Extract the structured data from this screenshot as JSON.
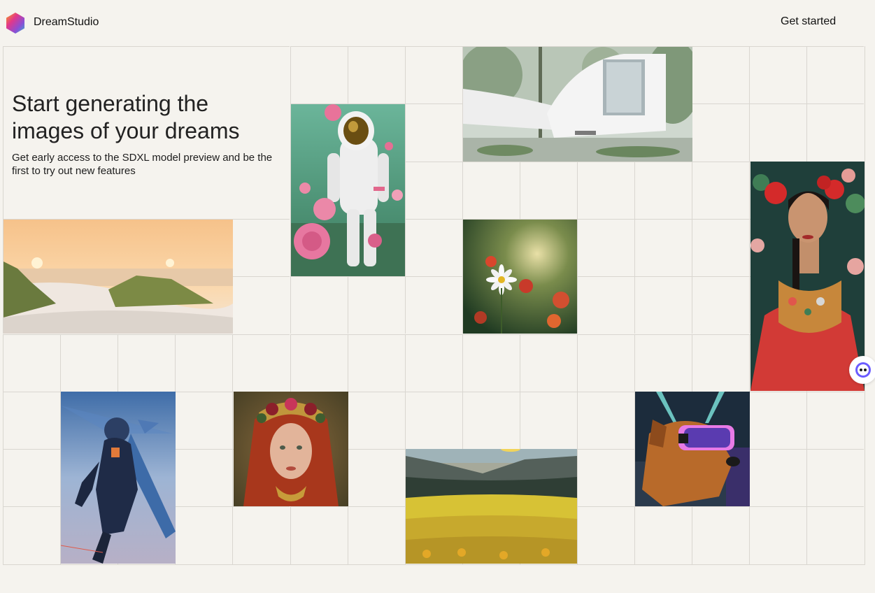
{
  "header": {
    "brand": "DreamStudio",
    "cta_label": "Get started"
  },
  "hero": {
    "headline": "Start generating the images of your dreams",
    "subtext": "Get early access to the SDXL model preview and be the first to try out new features"
  },
  "gallery": [
    {
      "name": "astronaut-roses-image",
      "subject": "astronaut among roses"
    },
    {
      "name": "modern-house-image",
      "subject": "white modern house in forest"
    },
    {
      "name": "beach-dunes-image",
      "subject": "sunset over beach dunes"
    },
    {
      "name": "daisy-flower-image",
      "subject": "daisy in garden"
    },
    {
      "name": "frida-portrait-image",
      "subject": "woman with red flowers portrait"
    },
    {
      "name": "space-warrior-image",
      "subject": "armored flying figure"
    },
    {
      "name": "red-hair-woman-image",
      "subject": "red-haired woman with floral crown"
    },
    {
      "name": "flower-valley-image",
      "subject": "yellow flower valley"
    },
    {
      "name": "vr-dog-image",
      "subject": "dog wearing VR headset"
    }
  ],
  "icons": {
    "logo": "hexagon-gradient-logo",
    "chat": "chat-bubble-icon"
  },
  "colors": {
    "background": "#f5f3ee",
    "grid_line": "#d9d6d0",
    "chat_accent": "#6b5cff"
  }
}
